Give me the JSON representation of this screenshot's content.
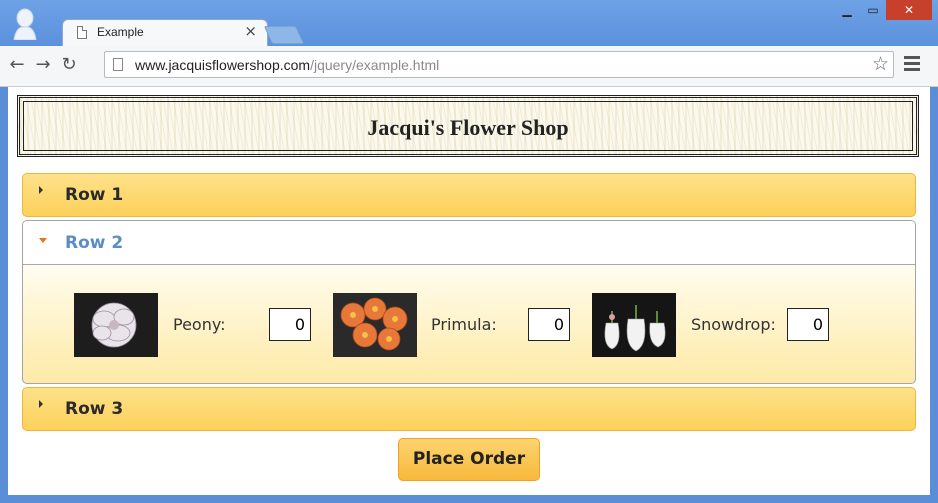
{
  "browser": {
    "tab_title": "Example",
    "url_host": "www.jacquisflowershop.com",
    "url_path": "/jquery/example.html"
  },
  "page": {
    "shop_title": "Jacqui's Flower Shop",
    "rows": [
      {
        "label": "Row 1",
        "expanded": false
      },
      {
        "label": "Row 2",
        "expanded": true
      },
      {
        "label": "Row 3",
        "expanded": false
      }
    ],
    "flowers": [
      {
        "name": "Peony:",
        "quantity": "0"
      },
      {
        "name": "Primula:",
        "quantity": "0"
      },
      {
        "name": "Snowdrop:",
        "quantity": "0"
      }
    ],
    "order_button": "Place Order"
  },
  "colors": {
    "accordion_header": "#fdd15a",
    "accordion_border": "#f2b53b",
    "active_label": "#5b8cc7",
    "active_arrow": "#e2781a"
  }
}
